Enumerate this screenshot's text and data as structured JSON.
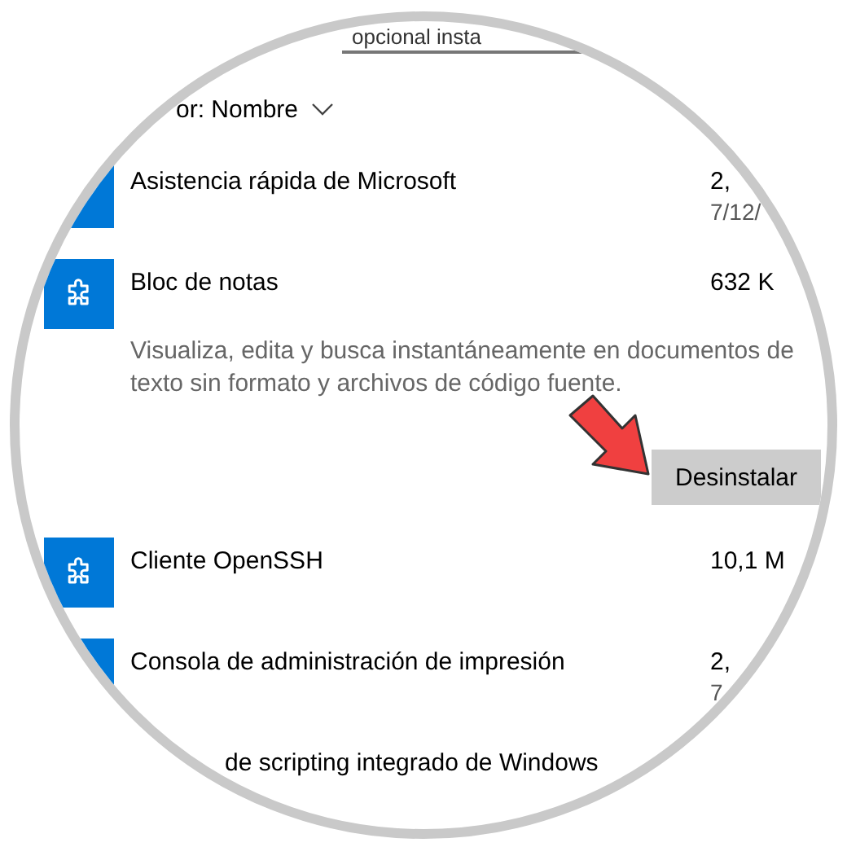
{
  "search": {
    "value": "opcional insta"
  },
  "sort": {
    "label": "or: Nombre"
  },
  "features": [
    {
      "kind": "clipped",
      "name": "Asistencia rápida de Microsoft",
      "size": "2,",
      "date": "7/12/",
      "expanded": false
    },
    {
      "kind": "normal",
      "name": "Bloc de notas",
      "size": "632 K",
      "expanded": true,
      "description": "Visualiza, edita y busca instantáneamente en documentos de texto sin formato y archivos de código fuente.",
      "button": "Desinstalar",
      "pointer_arrow": true
    },
    {
      "kind": "normal",
      "name": "Cliente OpenSSH",
      "size": "10,1 M",
      "expanded": false
    },
    {
      "kind": "clipped",
      "name": "Consola de administración de impresión",
      "size": "2,",
      "date": "7",
      "expanded": false
    },
    {
      "kind": "partial",
      "name": "de scripting integrado de Windows",
      "expanded": false
    }
  ]
}
